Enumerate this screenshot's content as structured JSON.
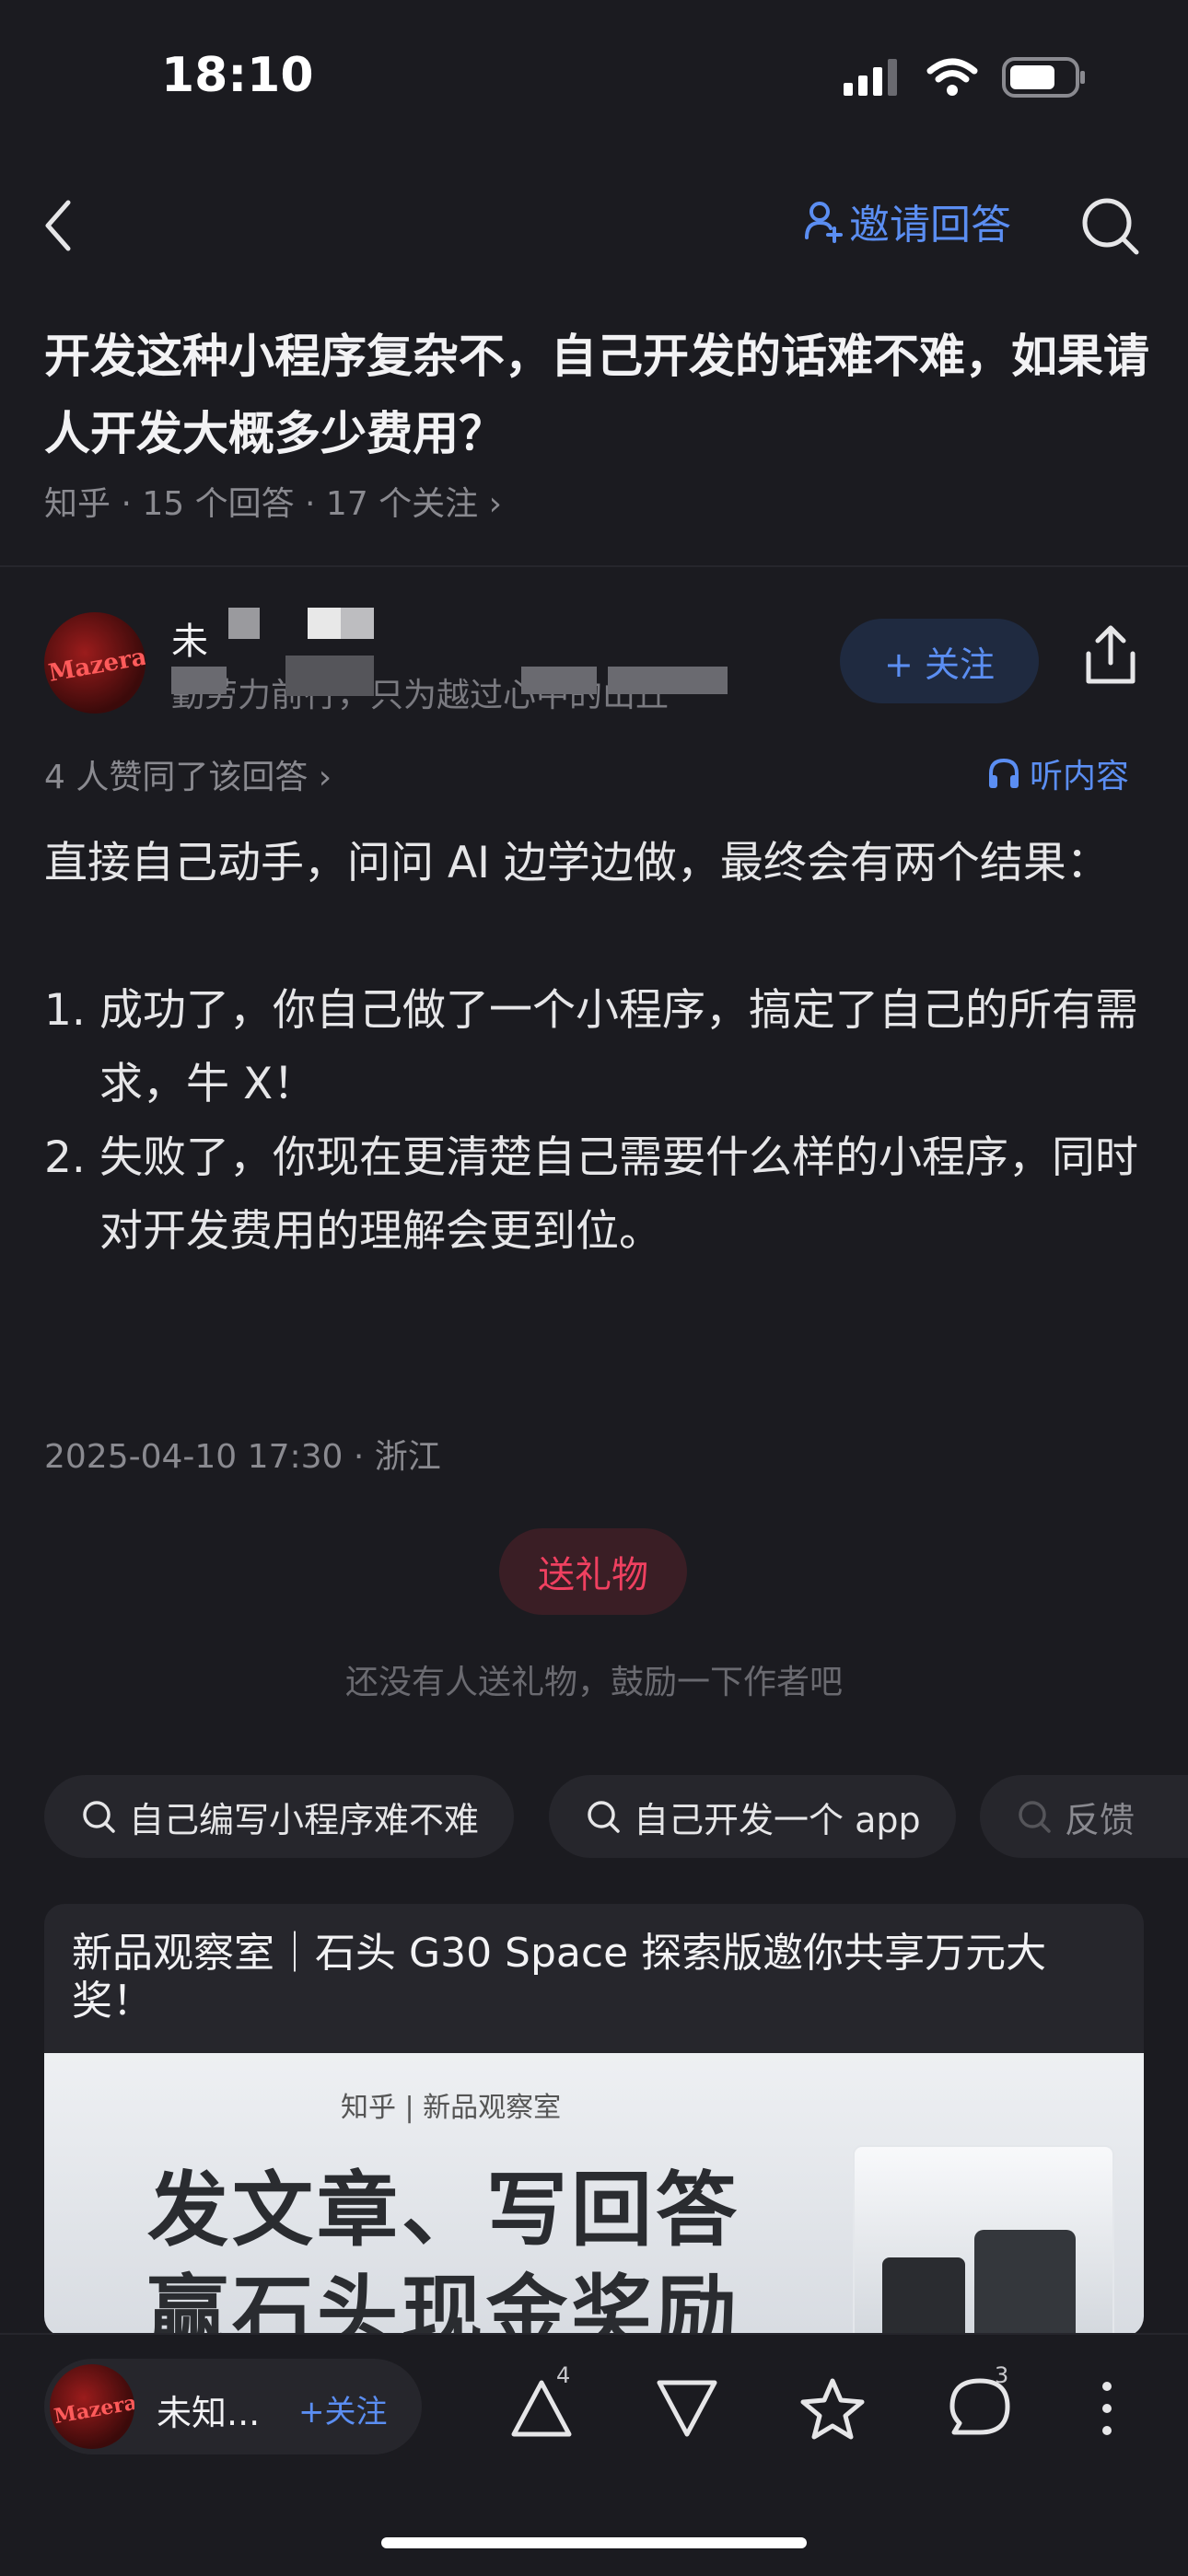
{
  "status_bar": {
    "time": "18:10"
  },
  "header": {
    "invite_label": "邀请回答"
  },
  "question": {
    "title": "开发这种小程序复杂不，自己开发的话难不难，如果请人开发大概多少费用？",
    "meta": "知乎 · 15 个回答 · 17 个关注 ›"
  },
  "author": {
    "name_visible": "未",
    "bio_visible": "勤劳力前行，只为越过心中的山丘",
    "avatar_text": "Mazerace",
    "follow_label": "+ 关注"
  },
  "answer": {
    "likes": "4 人赞同了该回答 ›",
    "listen_label": "听内容",
    "intro": "直接自己动手，问问 AI 边学边做，最终会有两个结果：",
    "items": [
      {
        "num": "1.",
        "text": "成功了，你自己做了一个小程序，搞定了自己的所有需求，牛 X！"
      },
      {
        "num": "2.",
        "text": "失败了，你现在更清楚自己需要什么样的小程序，同时对开发费用的理解会更到位。"
      }
    ],
    "date": "2025-04-10 17:30 · 浙江"
  },
  "gift": {
    "button": "送礼物",
    "hint": "还没有人送礼物，鼓励一下作者吧"
  },
  "chips": [
    {
      "label": "自己编写小程序难不难"
    },
    {
      "label": "自己开发一个 app"
    },
    {
      "label": "反馈"
    }
  ],
  "ad_card": {
    "title": "新品观察室｜石头 G30 Space 探索版邀你共享万元大奖！",
    "brand": "知乎 | 新品观察室",
    "line1": "发文章、写回答",
    "line2": "赢石头现金奖励"
  },
  "bottom_bar": {
    "author_name": "未知...",
    "follow_label": "+关注",
    "upvote_count": "4",
    "comment_count": "3"
  }
}
